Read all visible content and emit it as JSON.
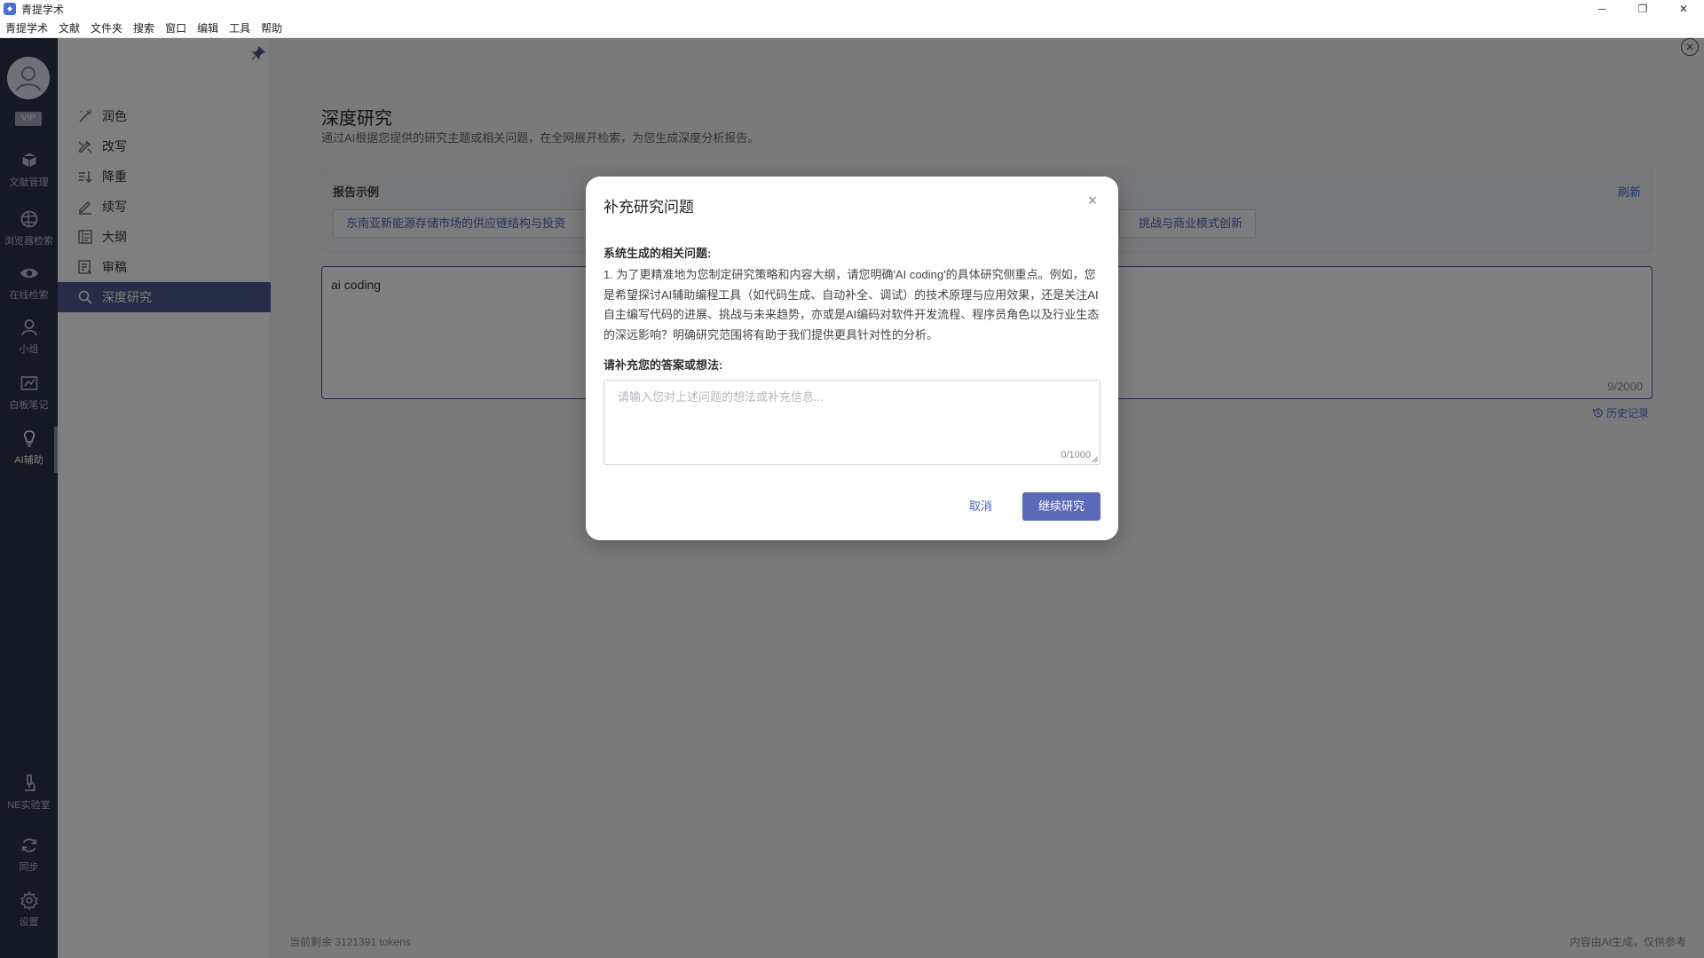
{
  "window": {
    "title": "青提学术",
    "controls": [
      "─",
      "❐",
      "✕"
    ]
  },
  "menu": [
    "青提学术",
    "文献",
    "文件夹",
    "搜索",
    "窗口",
    "编辑",
    "工具",
    "帮助"
  ],
  "rail": {
    "vip": "VIP",
    "items": [
      {
        "label": "文献管理",
        "icon": "box-icon"
      },
      {
        "label": "浏览器检索",
        "icon": "globe-icon"
      },
      {
        "label": "在线检索",
        "icon": "eye-icon"
      },
      {
        "label": "小组",
        "icon": "user-icon"
      },
      {
        "label": "白板笔记",
        "icon": "whiteboard-icon"
      },
      {
        "label": "AI辅助",
        "icon": "bulb-icon"
      },
      {
        "label": "NE实验室",
        "icon": "microscope-icon"
      },
      {
        "label": "同步",
        "icon": "sync-icon"
      },
      {
        "label": "设置",
        "icon": "gear-icon"
      }
    ]
  },
  "functions": [
    "润色",
    "改写",
    "降重",
    "续写",
    "大纲",
    "审稿",
    "深度研究"
  ],
  "main": {
    "title": "深度研究",
    "subtitle": "通过AI根据您提供的研究主题或相关问题，在全网展开检索，为您生成深度分析报告。",
    "examples_label": "报告示例",
    "refresh": "刷新",
    "examples": [
      "东南亚新能源存储市场的供应链结构与投资",
      "挑战与商业模式创新"
    ],
    "query": "ai coding",
    "query_count": "9/2000",
    "history": "历史记录",
    "tokens": "当前剩余 3121391 tokens",
    "ai_note": "内容由AI生成，仅供参考"
  },
  "modal": {
    "title": "补充研究问题",
    "close": "×",
    "questions_label": "系统生成的相关问题:",
    "question": "1. 为了更精准地为您制定研究策略和内容大纲，请您明确'AI coding'的具体研究侧重点。例如，您是希望探讨AI辅助编程工具（如代码生成、自动补全、调试）的技术原理与应用效果，还是关注AI自主编写代码的进展、挑战与未来趋势，亦或是AI编码对软件开发流程、程序员角色以及行业生态的深远影响？明确研究范围将有助于我们提供更具针对性的分析。",
    "answer_label": "请补充您的答案或想法:",
    "answer_placeholder": "请输入您对上述问题的想法或补充信息...",
    "answer_count": "0/1000",
    "cancel": "取消",
    "continue": "继续研究"
  }
}
